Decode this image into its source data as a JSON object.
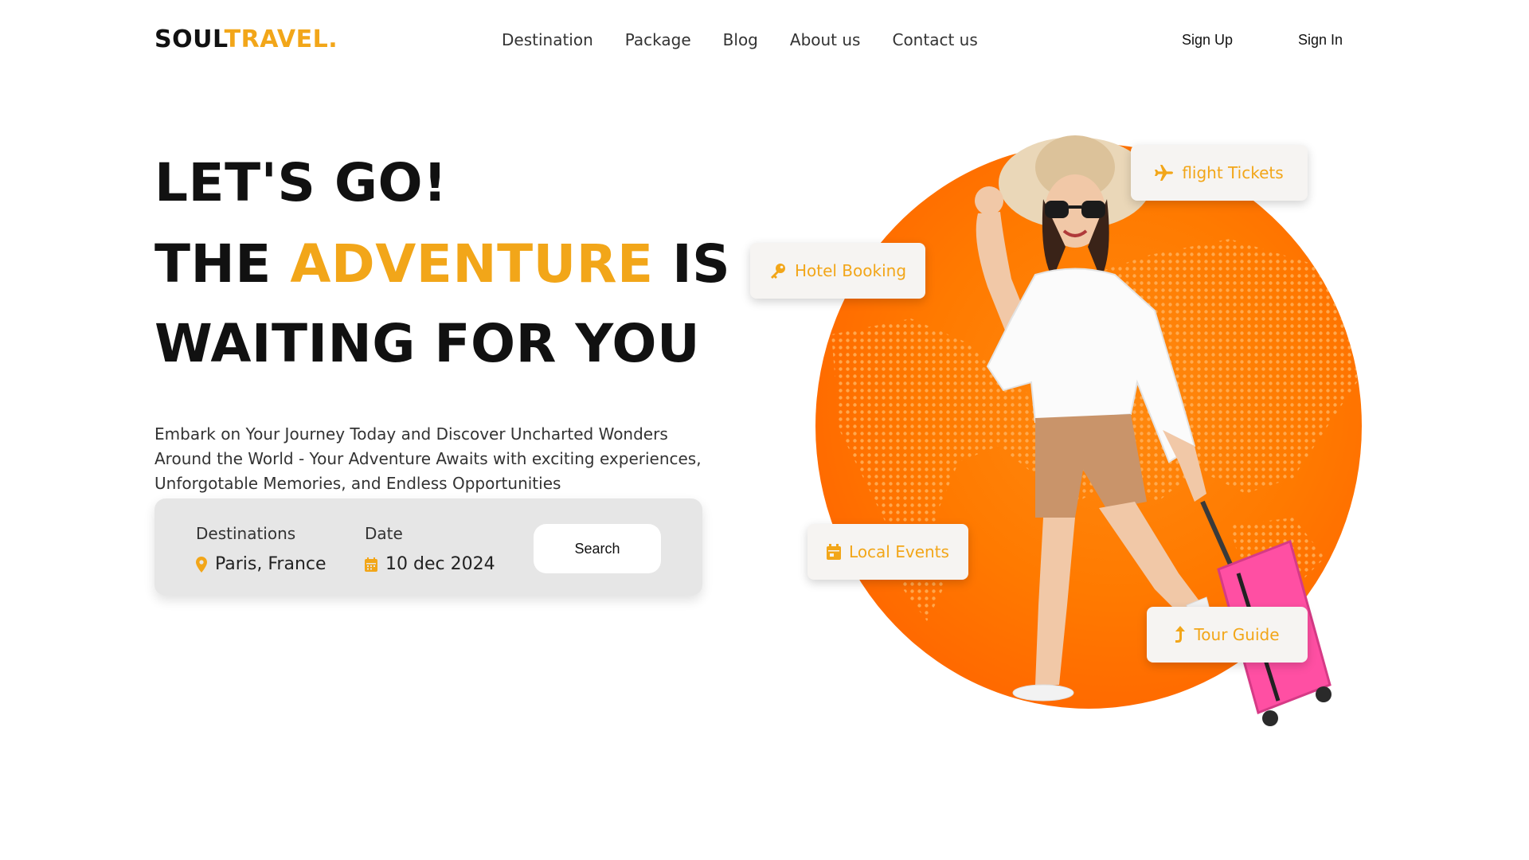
{
  "header": {
    "logo_part1": "SOUL",
    "logo_part2": "TRAVEL.",
    "nav": [
      "Destination",
      "Package",
      "Blog",
      "About us",
      "Contact us"
    ],
    "sign_up": "Sign Up",
    "sign_in": "Sign In"
  },
  "hero": {
    "line1": "LET'S GO!",
    "line2_start": "THE ",
    "line2_accent": "ADVENTURE",
    "line2_end": " IS",
    "line3": "WAITING FOR YOU",
    "description": "Embark on Your Journey Today and Discover Uncharted Wonders Around the World - Your Adventure Awaits with exciting experiences, Unforgotable Memories, and Endless Opportunities"
  },
  "search": {
    "destination_label": "Destinations",
    "destination_value": "Paris, France",
    "date_label": "Date",
    "date_value": "10 dec 2024",
    "button": "Search"
  },
  "features": {
    "flight": "flight Tickets",
    "hotel": "Hotel Booking",
    "events": "Local Events",
    "guide": "Tour Guide"
  },
  "icons": {
    "destination": "map-pin-icon",
    "date": "calendar-icon",
    "flight": "plane-icon",
    "hotel": "key-icon",
    "events": "calendar-icon",
    "guide": "arrow-up-icon"
  },
  "colors": {
    "accent": "#f2a619",
    "globe": "#ff7a00",
    "search_bg": "#e6e6e6",
    "suitcase": "#ff4fa3"
  }
}
